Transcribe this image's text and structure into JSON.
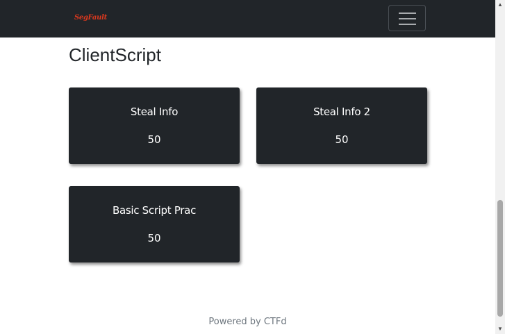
{
  "navbar": {
    "brand": "SegFault",
    "brand_color": "#d9381e",
    "toggler_icon": "hamburger-menu-icon"
  },
  "page": {
    "title": "ClientScript"
  },
  "challenges": [
    {
      "name": "Steal Info",
      "value": "50"
    },
    {
      "name": "Steal Info 2",
      "value": "50"
    },
    {
      "name": "Basic Script Prac",
      "value": "50"
    }
  ],
  "footer": {
    "text": "Powered by CTFd"
  },
  "scrollbar": {
    "up_icon": "scroll-up-arrow-icon",
    "down_icon": "scroll-down-arrow-icon"
  },
  "colors": {
    "navbar_bg": "#212529",
    "card_bg": "#212529",
    "footer_text": "#6c757d"
  }
}
